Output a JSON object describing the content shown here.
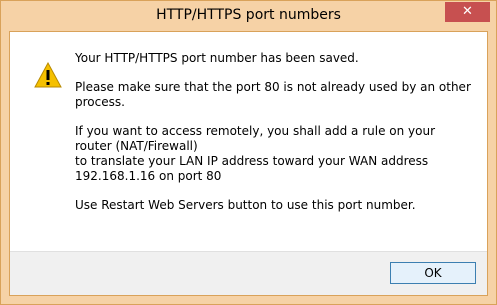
{
  "window": {
    "title": "HTTP/HTTPS port numbers",
    "close_glyph": "✕"
  },
  "message": {
    "icon": "warning-icon",
    "line1": "Your HTTP/HTTPS port number has been saved.",
    "line2": "Please make sure that the port 80 is not already used by an other process.",
    "line3": "If you want to access remotely, you shall add a rule on your router (NAT/Firewall)",
    "line4": "to translate your LAN IP address toward your WAN address 192.168.1.16 on port 80",
    "line5": "Use Restart Web Servers button to use this port number."
  },
  "footer": {
    "ok_label": "OK"
  },
  "colors": {
    "frame": "#f6d2a6",
    "close": "#c75050",
    "warning_fill": "#f5c000"
  }
}
